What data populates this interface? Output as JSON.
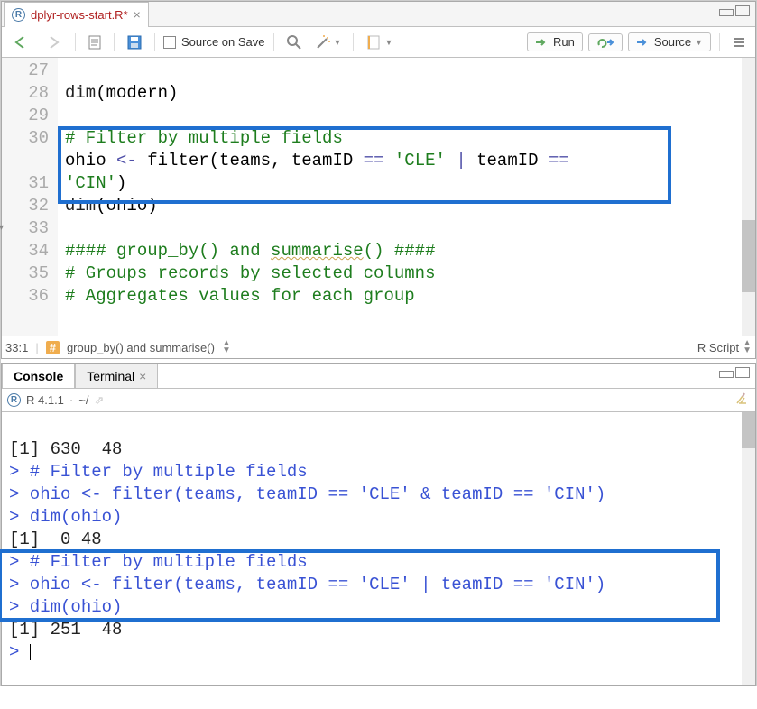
{
  "file": {
    "name": "dplyr-rows-start.R*",
    "icon": "R"
  },
  "toolbar": {
    "source_on_save": "Source on Save",
    "run": "Run",
    "source": "Source"
  },
  "lines": {
    "n27": "27",
    "n28": "28",
    "n29": "29",
    "n30": "30",
    "n31": "31",
    "n32": "32",
    "n33": "33",
    "n34": "34",
    "n35": "35",
    "n36": "36"
  },
  "code": {
    "l27a": "dim",
    "l27b": "(modern)",
    "l29": "# Filter by multiple fields",
    "l30a": "ohio ",
    "l30b": "<-",
    "l30c": " filter(teams, teamID ",
    "l30d": "==",
    "l30e": " ",
    "l30f": "'CLE'",
    "l30g": " ",
    "l30h": "|",
    "l30i": " teamID ",
    "l30j": "==",
    "l30k": " ",
    "l30x": "'CIN'",
    "l30y": ")",
    "l31a": "dim",
    "l31b": "(ohio)",
    "l33a": "#### group_by() and ",
    "l33b": "summarise",
    "l33c": "() ####",
    "l34": "# Groups records by selected columns",
    "l35": "# Aggregates values for each group"
  },
  "status": {
    "pos": "33:1",
    "section": "group_by() and summarise()",
    "lang": "R Script"
  },
  "console_tabs": {
    "console": "Console",
    "terminal": "Terminal"
  },
  "console": {
    "version": "R 4.1.1",
    "cwd": "~/"
  },
  "out": {
    "l1": "[1] 630  48",
    "l2p": ">",
    "l2": " # Filter by multiple fields",
    "l3p": ">",
    "l3": " ohio <- filter(teams, teamID == 'CLE' & teamID == 'CIN')",
    "l4p": ">",
    "l4": " dim(ohio)",
    "l5": "[1]  0 48",
    "l6p": ">",
    "l6": " # Filter by multiple fields",
    "l7p": ">",
    "l7": " ohio <- filter(teams, teamID == 'CLE' | teamID == 'CIN')",
    "l8p": ">",
    "l8": " dim(ohio)",
    "l9": "[1] 251  48",
    "l10p": ">",
    "l10": " "
  }
}
